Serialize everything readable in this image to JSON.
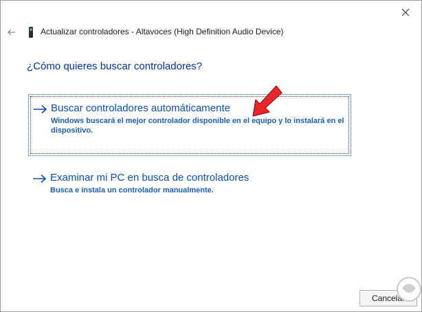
{
  "window": {
    "title": "Actualizar controladores - Altavoces (High Definition Audio Device)",
    "question": "¿Cómo quieres buscar controladores?"
  },
  "options": [
    {
      "title": "Buscar controladores automáticamente",
      "description": "Windows buscará el mejor controlador disponible en el equipo y lo instalará en el dispositivo."
    },
    {
      "title": "Examinar mi PC en busca de controladores",
      "description": "Busca e instala un controlador manualmente."
    }
  ],
  "footer": {
    "cancel_label": "Cancelar"
  },
  "icons": {
    "close": "close-icon",
    "back": "back-arrow-icon",
    "device": "speaker-device-icon",
    "option_arrow": "right-arrow-icon",
    "annotation": "red-pointer-arrow"
  },
  "colors": {
    "heading": "#003399",
    "link": "#0b4fa8",
    "description": "#1a5fb0",
    "annotation": "#e8262b"
  }
}
